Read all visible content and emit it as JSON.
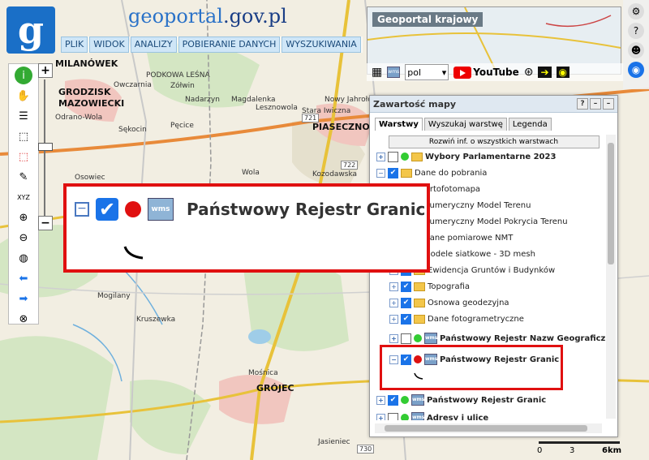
{
  "header": {
    "logo_letter": "g",
    "site_title_part1": "geoportal",
    "site_title_part2": ".gov.pl"
  },
  "menu": [
    "PLIK",
    "WIDOK",
    "ANALIZY",
    "POBIERANIE DANYCH",
    "WYSZUKIWANIA"
  ],
  "overview": {
    "title": "Geoportal krajowy",
    "language": "pol",
    "youtube_label": "YouTube"
  },
  "map_labels": {
    "cities": [
      "MILANÓWEK",
      "GRODZISK",
      "MAZOWIECKI",
      "PIASECZNO",
      "GRÓJEC"
    ],
    "towns": [
      "PODKOWA LEŚNA",
      "Owczarnia",
      "Zółwin",
      "Nadarzyn",
      "Magdalenka",
      "Lesznowola",
      "Stara Iwiczna",
      "Kozodawska",
      "Wola",
      "Osowiec",
      "Odrano-Wola",
      "Sękocin",
      "Pęcice",
      "Nowy Jahrołów",
      "Mogilany",
      "Kruszewka",
      "Mośnica",
      "Jasieniec"
    ],
    "roads": [
      "721",
      "722",
      "730"
    ]
  },
  "panel": {
    "title": "Zawartość mapy",
    "tabs": [
      "Warstwy",
      "Wyszukaj warstwę",
      "Legenda"
    ],
    "expand_button": "Rozwiń inf. o wszystkich warstwach",
    "layers": [
      {
        "label": "Wybory Parlamentarne 2023",
        "bold": true
      },
      {
        "label": "Dane do pobrania",
        "bold": false
      },
      {
        "label": "Ortofotomapa",
        "bold": false
      },
      {
        "label": "Numeryczny Model Terenu",
        "bold": false
      },
      {
        "label": "Numeryczny Model Pokrycia Terenu",
        "bold": false
      },
      {
        "label": "Dane pomiarowe NMT",
        "bold": false
      },
      {
        "label": "Modele siatkowe - 3D mesh",
        "bold": false
      },
      {
        "label": "Ewidencja Gruntów i Budynków",
        "bold": false
      },
      {
        "label": "Topografia",
        "bold": false
      },
      {
        "label": "Osnowa geodezyjna",
        "bold": false
      },
      {
        "label": "Dane fotogrametryczne",
        "bold": false
      },
      {
        "label": "Państwowy Rejestr Nazw Geograficzny",
        "bold": true
      },
      {
        "label": "Państwowy Rejestr Granic",
        "bold": true
      },
      {
        "label": "Państwowy Rejestr Granic",
        "bold": true
      },
      {
        "label": "Adresy i ulice",
        "bold": true
      }
    ]
  },
  "callout": {
    "label": "Państwowy Rejestr Granic"
  },
  "scale": {
    "labels": [
      "0",
      "3",
      "6km"
    ]
  },
  "icons": {
    "wms": "wms"
  }
}
